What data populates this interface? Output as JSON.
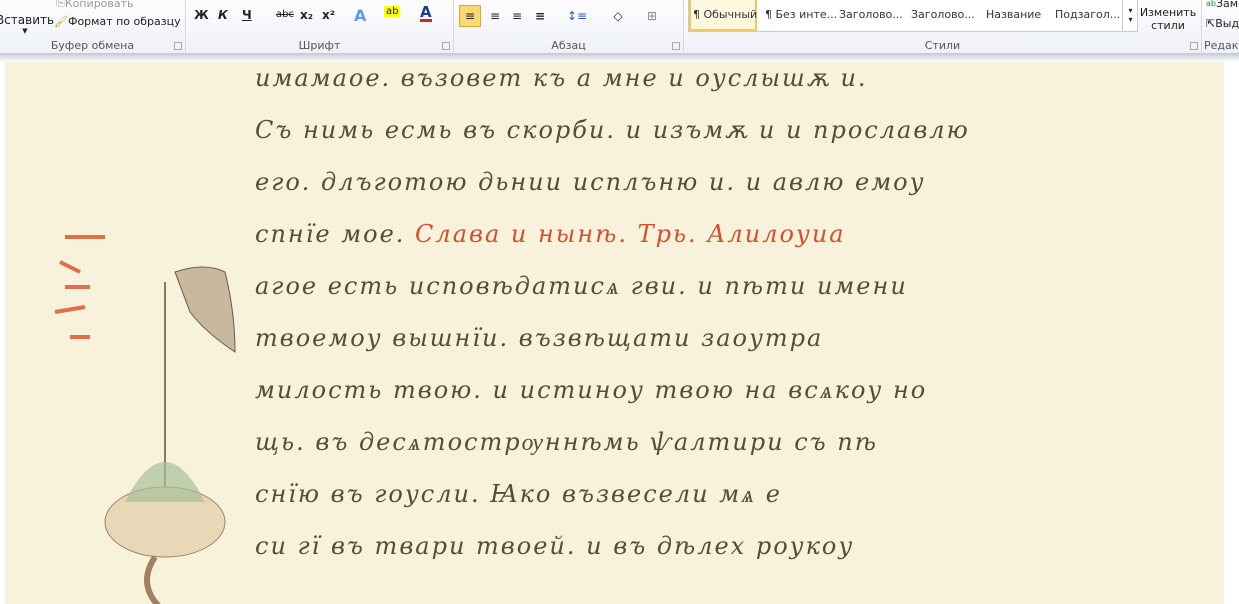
{
  "ribbon": {
    "clipboard": {
      "paste": "Вставить",
      "copy": "Копировать",
      "format_painter": "Формат по образцу",
      "label": "Буфер обмена"
    },
    "font": {
      "bold": "Ж",
      "italic": "К",
      "underline": "Ч",
      "strike": "abc",
      "subscript": "x₂",
      "superscript": "x²",
      "label": "Шрифт"
    },
    "paragraph": {
      "label": "Абзац"
    },
    "styles": {
      "items": [
        "¶ Обычный",
        "¶ Без инте...",
        "Заголово...",
        "Заголово...",
        "Название",
        "Подзагол..."
      ],
      "change": "Изменить стили",
      "label": "Стили"
    },
    "editing": {
      "replace": "Заменить",
      "select": "Выделить",
      "label": "Редактирование"
    }
  },
  "document": {
    "lines": [
      {
        "text": "имамаое. възовет къ а мне и оуслышѫ и.",
        "red": ""
      },
      {
        "text": "Съ нимь есмь въ скорби. и изъмѫ и и прославлю",
        "red": ""
      },
      {
        "text": "его. длъготою дьнии исплъню и. и авлю емоу",
        "red": ""
      },
      {
        "text": "спнїе мое.",
        "red": "Слава и нынѣ. Трь. Алилоуиа"
      },
      {
        "text": "агое есть исповѣдатисѧ гви. и пѣти имени",
        "red": ""
      },
      {
        "text": "твоемоу вышнїи. възвѣщати заоутра",
        "red": ""
      },
      {
        "text": "милость твою. и истиноу твою на всѧкоу но",
        "red": ""
      },
      {
        "text": "щь. въ десѧтострѹннѣмь ѱалтири съ пѣ",
        "red": ""
      },
      {
        "text": "снїю въ гоусли. Ꙗко възвесели мѧ е",
        "red": ""
      },
      {
        "text": "си гї въ твари твоей. и въ дѣлех роукоу",
        "red": ""
      }
    ]
  }
}
